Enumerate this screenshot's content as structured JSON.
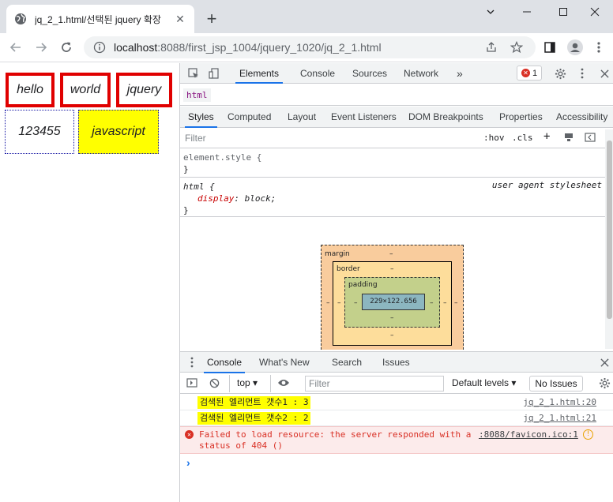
{
  "browser": {
    "tab_title": "jq_2_1.html/선택된 jquery 확장",
    "new_tab_symbol": "+",
    "url_host": "localhost",
    "url_path": ":8088/first_jsp_1004/jquery_1020/jq_2_1.html"
  },
  "page": {
    "boxes": [
      {
        "text": "hello",
        "style": "red"
      },
      {
        "text": "world",
        "style": "red"
      },
      {
        "text": "jquery",
        "style": "red"
      },
      {
        "text": "123455",
        "style": "blue"
      },
      {
        "text": "javascript",
        "style": "blue-yellow"
      }
    ]
  },
  "devtools": {
    "tabs": [
      "Elements",
      "Console",
      "Sources",
      "Network"
    ],
    "more_tabs_symbol": "»",
    "error_count": "1",
    "breadcrumb": "html",
    "subtabs": [
      "Styles",
      "Computed",
      "Layout",
      "Event Listeners",
      "DOM Breakpoints",
      "Properties",
      "Accessibility"
    ],
    "filter_placeholder": "Filter",
    "hov_label": ":hov",
    "cls_label": ".cls",
    "rules": {
      "element_style_selector": "element.style {",
      "close_brace": "}",
      "html_selector": "html {",
      "html_source": "user agent stylesheet",
      "html_prop": "display",
      "html_val": "block;"
    },
    "box_model": {
      "margin_label": "margin",
      "border_label": "border",
      "padding_label": "padding",
      "content_size": "229×122.656",
      "dash": "–"
    },
    "drawer": {
      "tabs": [
        "Console",
        "What's New",
        "Search",
        "Issues"
      ],
      "context": "top",
      "filter_placeholder": "Filter",
      "levels": "Default levels",
      "no_issues": "No Issues"
    },
    "console": {
      "logs": [
        {
          "text": "검색된 엘리먼트 갯수1 : 3",
          "link": "jq_2_1.html:20"
        },
        {
          "text": "검색된 엘리먼트 갯수2 : 2",
          "link": "jq_2_1.html:21"
        }
      ],
      "error_text": "Failed to load resource: the server responded with a status of 404 ()",
      "error_link": ":8088/favicon.ico:1",
      "prompt": "›"
    }
  },
  "colors": {
    "red_border": "#e00000",
    "yellow_bg": "#ffff00",
    "blue_border": "#1a1aa6",
    "accent": "#1a73e8"
  }
}
